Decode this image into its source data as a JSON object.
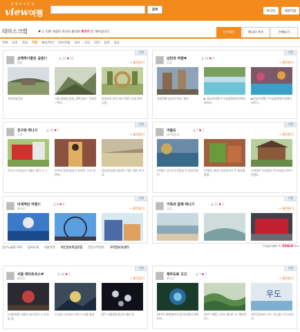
{
  "header": {
    "logo_small": "여 행 포 스 트 링",
    "logo_main": "view",
    "logo_ko": "여행",
    "search_placeholder": "",
    "search_button": "검색",
    "login": "로그인",
    "join": "회원가입"
  },
  "title": {
    "text": "테마스크랩",
    "sub_prefix": "♥ 는 다른 사람이 자신의 폴더로",
    "sub_highlight": "퍼가기",
    "sub_suffix": "한 개수입니다."
  },
  "tabs": [
    "인기테마",
    "에디터 추천",
    "전체보기"
  ],
  "categories": [
    "전체",
    "요리",
    "진업",
    "여행",
    "패션/뷰티",
    "DIY/리폼",
    "육아",
    "건강",
    "리뷰",
    "문화",
    "일상"
  ],
  "card_tag": "여행",
  "follow_label": "+ 폴더담기",
  "cards": [
    {
      "title": "산책하기좋은 공원!!",
      "user": "울랄",
      "posts": "12",
      "hearts": "13",
      "captions": [
        "게이데광공원",
        "서울 생태길 탐방_경복궁방~ 인왕산~북악..",
        "마법지로 같이 떠난 편안, 감성 편지공원."
      ]
    },
    {
      "title": "낭만과 여행♥",
      "user": "소망",
      "posts": "14",
      "hearts": "0",
      "captions": [
        "유럽여행 낭만과 여유, 벨라",
        "▶ 동남아여행 수수&플랜테이션해리테이지..",
        "▶동남아여행 수수&플랜테이션해리 테이디.."
      ]
    },
    {
      "title": "친구와 떠나기",
      "user": "소망",
      "posts": "10",
      "hearts": "7",
      "captions": [
        "독서고 미국효과 더할분 알려 기 :)",
        "아이와 함께 놀상지 포천전, 우리 전원에..",
        "[동일후원중] 블로운 이용, 예정 보아 요,"
      ]
    },
    {
      "title": "겨울도",
      "user": "남포동동장",
      "posts": "7",
      "hearts": "1",
      "captions": [
        "[겨울도 당기] 뒤 4명굴 모 음진전영이",
        "[겨울도 봄맛] 옹송피의크 된 통동통흉펼..",
        "드래말로 빈연중간 여 비되밀 러이드[원돌].."
      ]
    },
    {
      "title": "이색적인 여행!!",
      "user": "울라갔",
      "posts": "8",
      "hearts": "0",
      "captions": [
        "",
        "",
        ""
      ]
    },
    {
      "title": "가족과 함께 떠나기",
      "user": "소망",
      "posts": "11",
      "hearts": "5",
      "captions": [
        "",
        "",
        ""
      ]
    },
    {
      "title": "서울 데이트코스♥",
      "user": "울라갔",
      "posts": "16",
      "hearts": "5",
      "captions": [
        "[서울여행] 서울이 놀이공자 시 인사동 탐..",
        "인사동~(속부터 겨리~) 서울 통로",
        "DIY 서울동화정당의 행산 동"
      ]
    },
    {
      "title": "제주도로 고고",
      "user": "울라갔",
      "posts": "7",
      "hearts": "5",
      "captions": [
        "[제주도여행]제주도맛(10)평대 해외변지...",
        "[제주 여행] 나르만 풀티트 다 해외변(1)..",
        "제주맛집에서 우도 가는월 / 우도바이지.."
      ]
    }
  ],
  "footer": {
    "links": [
      "일고노을의 모아",
      "정사소개",
      "이용약관",
      "개인정보취급방침",
      "전인스부감자",
      "자격권보호센터"
    ],
    "copyright_prefix": "Copyright ©",
    "copyright_brand": "EZHLD",
    "copyright_suffix": "Inc"
  }
}
